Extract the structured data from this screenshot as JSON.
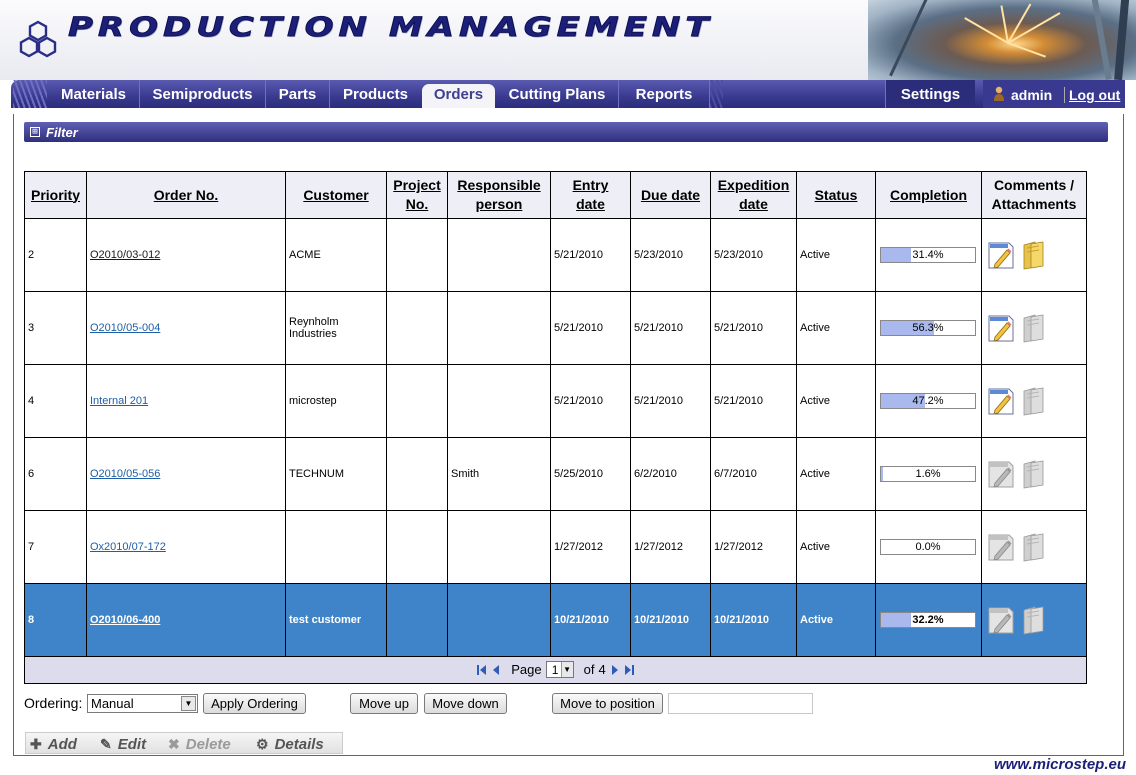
{
  "header": {
    "app_title": "PRODUCTION MANAGEMENT"
  },
  "nav": {
    "items": [
      {
        "label": "Materials"
      },
      {
        "label": "Semiproducts"
      },
      {
        "label": "Parts"
      },
      {
        "label": "Products"
      },
      {
        "label": "Orders"
      },
      {
        "label": "Cutting Plans"
      },
      {
        "label": "Reports"
      }
    ],
    "active": "Orders",
    "settings": "Settings",
    "user": "admin",
    "logout": "Log out"
  },
  "filter": {
    "toggle": "⊞",
    "label": "Filter"
  },
  "table": {
    "headers": {
      "priority": "Priority",
      "order_no": "Order No.",
      "customer": "Customer",
      "project_no_1": "Project",
      "project_no_2": "No.",
      "responsible_1": "Responsible",
      "responsible_2": "person",
      "entry_1": "Entry",
      "entry_2": "date",
      "due": "Due date",
      "expedition_1": "Expedition",
      "expedition_2": "date",
      "status": "Status",
      "completion": "Completion",
      "comments_1": "Comments /",
      "comments_2": "Attachments"
    },
    "rows": [
      {
        "priority": "2",
        "order_no": "O2010/03-012",
        "customer": "ACME",
        "project_no": "",
        "responsible": "",
        "entry": "5/21/2010",
        "due": "5/23/2010",
        "expedition": "5/23/2010",
        "status": "Active",
        "completion": "31.4%",
        "completion_value": 0.314,
        "has_comment": true,
        "has_attachment": true
      },
      {
        "priority": "3",
        "order_no": "O2010/05-004",
        "customer": "Reynholm Industries",
        "project_no": "",
        "responsible": "",
        "entry": "5/21/2010",
        "due": "5/21/2010",
        "expedition": "5/21/2010",
        "status": "Active",
        "completion": "56.3%",
        "completion_value": 0.563,
        "has_comment": true,
        "has_attachment": false
      },
      {
        "priority": "4",
        "order_no": "Internal 201",
        "customer": "microstep",
        "project_no": "",
        "responsible": "",
        "entry": "5/21/2010",
        "due": "5/21/2010",
        "expedition": "5/21/2010",
        "status": "Active",
        "completion": "47.2%",
        "completion_value": 0.472,
        "has_comment": true,
        "has_attachment": false
      },
      {
        "priority": "6",
        "order_no": "O2010/05-056",
        "customer": "TECHNUM",
        "project_no": "",
        "responsible": "Smith",
        "entry": "5/25/2010",
        "due": "6/2/2010",
        "expedition": "6/7/2010",
        "status": "Active",
        "completion": "1.6%",
        "completion_value": 0.016,
        "has_comment": false,
        "has_attachment": false
      },
      {
        "priority": "7",
        "order_no": "Ox2010/07-172",
        "customer": "",
        "project_no": "",
        "responsible": "",
        "entry": "1/27/2012",
        "due": "1/27/2012",
        "expedition": "1/27/2012",
        "status": "Active",
        "completion": "0.0%",
        "completion_value": 0.0,
        "has_comment": false,
        "has_attachment": false
      },
      {
        "priority": "8",
        "order_no": "O2010/06-400",
        "customer": "test customer",
        "project_no": "",
        "responsible": "",
        "entry": "10/21/2010",
        "due": "10/21/2010",
        "expedition": "10/21/2010",
        "status": "Active",
        "completion": "32.2%",
        "completion_value": 0.322,
        "has_comment": false,
        "has_attachment": false,
        "selected": true
      }
    ]
  },
  "pager": {
    "page_label": "Page",
    "current": "1",
    "of_label": "of",
    "total": "4"
  },
  "ordering": {
    "label": "Ordering:",
    "value": "Manual",
    "apply": "Apply Ordering",
    "move_up": "Move up",
    "move_down": "Move down",
    "move_to_position": "Move to position",
    "position_value": ""
  },
  "actions": {
    "add": "Add",
    "edit": "Edit",
    "delete": "Delete",
    "details": "Details"
  },
  "footer": {
    "link": "www.microstep.eu"
  },
  "colors": {
    "brand": "#2b2c7a",
    "selected_row": "#3f84c8",
    "progress_fill": "#a9b9ee"
  }
}
